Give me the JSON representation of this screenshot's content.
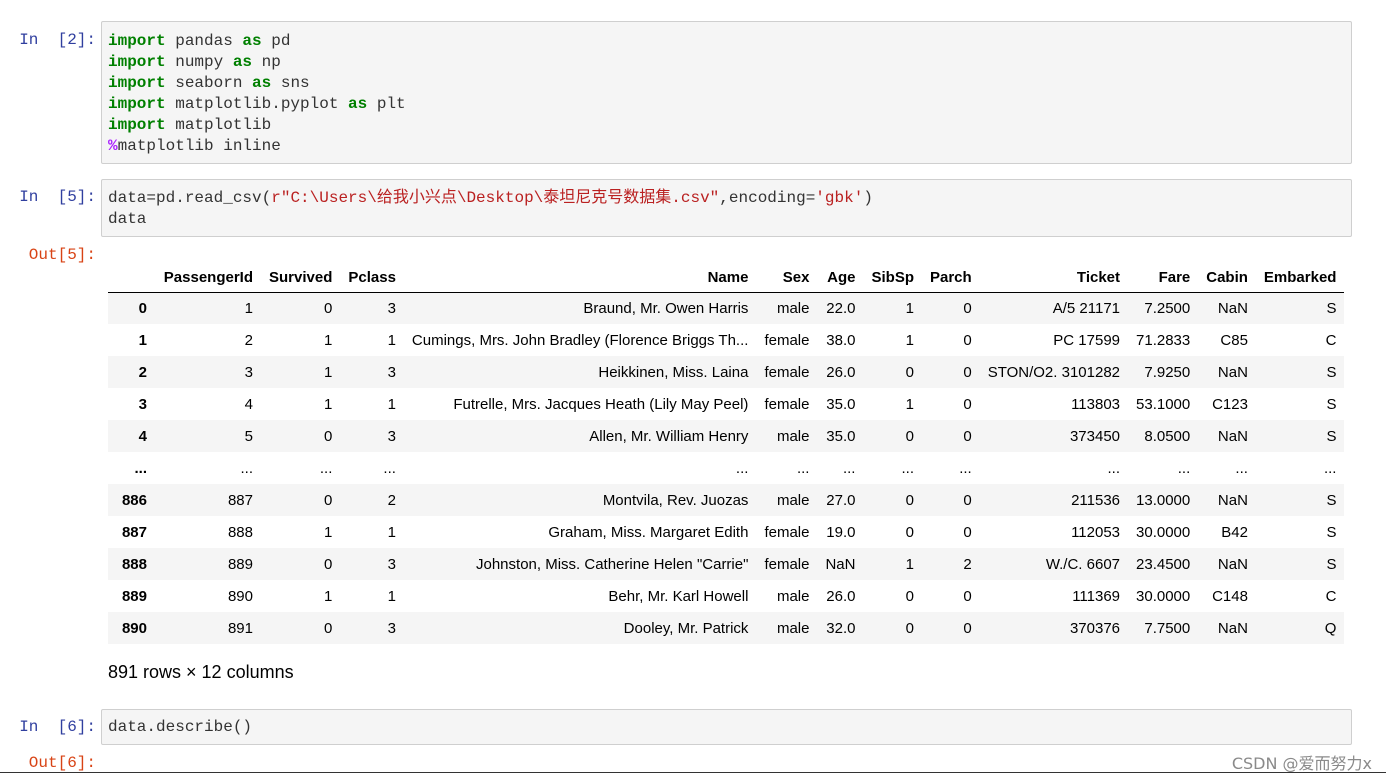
{
  "cells": {
    "c1": {
      "prompt": "In  [2]:",
      "lines": [
        {
          "kw": "import",
          "mod": " pandas ",
          "as": "as",
          "alias": " pd"
        },
        {
          "kw": "import",
          "mod": " numpy ",
          "as": "as",
          "alias": " np"
        },
        {
          "kw": "import",
          "mod": " seaborn ",
          "as": "as",
          "alias": " sns"
        },
        {
          "kw": "import",
          "mod": " matplotlib.pyplot ",
          "as": "as",
          "alias": " plt"
        },
        {
          "kw": "import",
          "mod": " matplotlib",
          "as": "",
          "alias": ""
        }
      ],
      "magic_symbol": "%",
      "magic_rest": "matplotlib inline"
    },
    "c2": {
      "prompt": "In  [5]:",
      "line1_a": "data=pd.read_csv(",
      "line1_str1": "r\"C:\\Users\\给我小兴点\\Desktop\\泰坦尼克号数据集.csv\"",
      "line1_b": ",encoding=",
      "line1_str2": "'gbk'",
      "line1_c": ")",
      "line2": "data",
      "out_prompt": "Out[5]:"
    },
    "c3": {
      "prompt": "In  [6]:",
      "line1": "data.describe()",
      "out_prompt": "Out[6]:"
    }
  },
  "dataframe": {
    "columns": [
      "",
      "PassengerId",
      "Survived",
      "Pclass",
      "Name",
      "Sex",
      "Age",
      "SibSp",
      "Parch",
      "Ticket",
      "Fare",
      "Cabin",
      "Embarked"
    ],
    "rows": [
      [
        "0",
        "1",
        "0",
        "3",
        "Braund, Mr. Owen Harris",
        "male",
        "22.0",
        "1",
        "0",
        "A/5 21171",
        "7.2500",
        "NaN",
        "S"
      ],
      [
        "1",
        "2",
        "1",
        "1",
        "Cumings, Mrs. John Bradley (Florence Briggs Th...",
        "female",
        "38.0",
        "1",
        "0",
        "PC 17599",
        "71.2833",
        "C85",
        "C"
      ],
      [
        "2",
        "3",
        "1",
        "3",
        "Heikkinen, Miss. Laina",
        "female",
        "26.0",
        "0",
        "0",
        "STON/O2. 3101282",
        "7.9250",
        "NaN",
        "S"
      ],
      [
        "3",
        "4",
        "1",
        "1",
        "Futrelle, Mrs. Jacques Heath (Lily May Peel)",
        "female",
        "35.0",
        "1",
        "0",
        "113803",
        "53.1000",
        "C123",
        "S"
      ],
      [
        "4",
        "5",
        "0",
        "3",
        "Allen, Mr. William Henry",
        "male",
        "35.0",
        "0",
        "0",
        "373450",
        "8.0500",
        "NaN",
        "S"
      ],
      [
        "...",
        "...",
        "...",
        "...",
        "...",
        "...",
        "...",
        "...",
        "...",
        "...",
        "...",
        "...",
        "..."
      ],
      [
        "886",
        "887",
        "0",
        "2",
        "Montvila, Rev. Juozas",
        "male",
        "27.0",
        "0",
        "0",
        "211536",
        "13.0000",
        "NaN",
        "S"
      ],
      [
        "887",
        "888",
        "1",
        "1",
        "Graham, Miss. Margaret Edith",
        "female",
        "19.0",
        "0",
        "0",
        "112053",
        "30.0000",
        "B42",
        "S"
      ],
      [
        "888",
        "889",
        "0",
        "3",
        "Johnston, Miss. Catherine Helen \"Carrie\"",
        "female",
        "NaN",
        "1",
        "2",
        "W./C. 6607",
        "23.4500",
        "NaN",
        "S"
      ],
      [
        "889",
        "890",
        "1",
        "1",
        "Behr, Mr. Karl Howell",
        "male",
        "26.0",
        "0",
        "0",
        "111369",
        "30.0000",
        "C148",
        "C"
      ],
      [
        "890",
        "891",
        "0",
        "3",
        "Dooley, Mr. Patrick",
        "male",
        "32.0",
        "0",
        "0",
        "370376",
        "7.7500",
        "NaN",
        "Q"
      ]
    ],
    "shape_text": "891 rows × 12 columns"
  },
  "watermark": "CSDN @爱而努力x",
  "colors": {
    "in_prompt": "#303f9f",
    "out_prompt": "#d84315",
    "keyword": "#008000",
    "magic": "#aa22ff",
    "string": "#ba2121"
  }
}
